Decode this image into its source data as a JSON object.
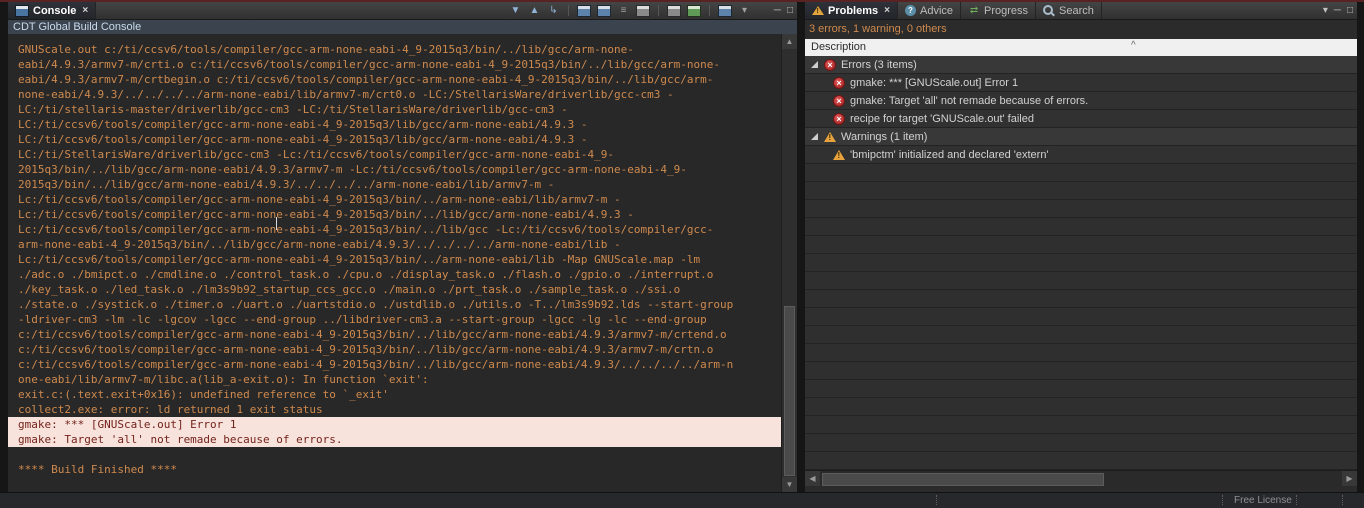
{
  "glyphs": {
    "close": "×"
  },
  "colors": {
    "accent_maroon": "#5a2323",
    "console_text": "#cf8a4e",
    "error_line_bg": "#f7e2dc",
    "error_line_text": "#74231b",
    "error_icon": "#b32424",
    "warning_icon": "#e8a33d"
  },
  "console_view": {
    "tab_label": "Console",
    "subtitle": "CDT Global Build Console",
    "toolbar": [
      {
        "name": "next-error-icon",
        "glyph": "▼",
        "cls": "blue"
      },
      {
        "name": "previous-error-icon",
        "glyph": "▲",
        "cls": "blue"
      },
      {
        "name": "show-error-in-editor-icon",
        "glyph": "↳",
        "cls": "blue"
      },
      {
        "sep": true
      },
      {
        "name": "copy-build-log-icon",
        "win": ""
      },
      {
        "name": "open-build-console-icon",
        "win": ""
      },
      {
        "name": "word-wrap-icon",
        "glyph": "≡",
        "cls": "gray"
      },
      {
        "name": "clear-console-icon",
        "win": "gray"
      },
      {
        "sep": true
      },
      {
        "name": "scroll-lock-icon",
        "win": "gray"
      },
      {
        "name": "pin-console-icon",
        "win": "green"
      },
      {
        "sep": true
      },
      {
        "name": "display-selected-console-icon",
        "win": ""
      },
      {
        "name": "open-console-dropdown-icon",
        "glyph": "▾",
        "cls": "gray"
      }
    ],
    "window_icons": [
      {
        "name": "minimize-icon",
        "glyph": "─"
      },
      {
        "name": "maximize-icon",
        "glyph": "□"
      }
    ],
    "lines": [
      {
        "text": "GNUScale.out c:/ti/ccsv6/tools/compiler/gcc-arm-none-eabi-4_9-2015q3/bin/../lib/gcc/arm-none-"
      },
      {
        "text": "eabi/4.9.3/armv7-m/crti.o c:/ti/ccsv6/tools/compiler/gcc-arm-none-eabi-4_9-2015q3/bin/../lib/gcc/arm-none-"
      },
      {
        "text": "eabi/4.9.3/armv7-m/crtbegin.o c:/ti/ccsv6/tools/compiler/gcc-arm-none-eabi-4_9-2015q3/bin/../lib/gcc/arm-"
      },
      {
        "text": "none-eabi/4.9.3/../../../../arm-none-eabi/lib/armv7-m/crt0.o -LC:/StellarisWare/driverlib/gcc-cm3 -"
      },
      {
        "text": "LC:/ti/stellaris-master/driverlib/gcc-cm3 -LC:/ti/StellarisWare/driverlib/gcc-cm3 -"
      },
      {
        "text": "LC:/ti/ccsv6/tools/compiler/gcc-arm-none-eabi-4_9-2015q3/lib/gcc/arm-none-eabi/4.9.3 -"
      },
      {
        "text": "LC:/ti/ccsv6/tools/compiler/gcc-arm-none-eabi-4_9-2015q3/lib/gcc/arm-none-eabi/4.9.3 -"
      },
      {
        "text": "LC:/ti/StellarisWare/driverlib/gcc-cm3 -Lc:/ti/ccsv6/tools/compiler/gcc-arm-none-eabi-4_9-"
      },
      {
        "text": "2015q3/bin/../lib/gcc/arm-none-eabi/4.9.3/armv7-m -Lc:/ti/ccsv6/tools/compiler/gcc-arm-none-eabi-4_9-"
      },
      {
        "text": "2015q3/bin/../lib/gcc/arm-none-eabi/4.9.3/../../../../arm-none-eabi/lib/armv7-m -"
      },
      {
        "text": "Lc:/ti/ccsv6/tools/compiler/gcc-arm-none-eabi-4_9-2015q3/bin/../arm-none-eabi/lib/armv7-m -"
      },
      {
        "text": "Lc:/ti/ccsv6/tools/compiler/gcc-arm-none-eabi-4_9-2015q3/bin/../lib/gcc/arm-none-eabi/4.9.3 -"
      },
      {
        "text": "Lc:/ti/ccsv6/tools/compiler/gcc-arm-none-eabi-4_9-2015q3/bin/../lib/gcc -Lc:/ti/ccsv6/tools/compiler/gcc-"
      },
      {
        "text": "arm-none-eabi-4_9-2015q3/bin/../lib/gcc/arm-none-eabi/4.9.3/../../../../arm-none-eabi/lib -"
      },
      {
        "text": "Lc:/ti/ccsv6/tools/compiler/gcc-arm-none-eabi-4_9-2015q3/bin/../arm-none-eabi/lib -Map GNUScale.map -lm"
      },
      {
        "text": "./adc.o ./bmipct.o ./cmdline.o ./control_task.o ./cpu.o ./display_task.o ./flash.o ./gpio.o ./interrupt.o"
      },
      {
        "text": "./key_task.o ./led_task.o ./lm3s9b92_startup_ccs_gcc.o ./main.o ./prt_task.o ./sample_task.o ./ssi.o"
      },
      {
        "text": "./state.o ./systick.o ./timer.o ./uart.o ./uartstdio.o ./ustdlib.o ./utils.o -T../lm3s9b92.lds --start-group"
      },
      {
        "text": "-ldriver-cm3 -lm -lc -lgcov -lgcc --end-group ../libdriver-cm3.a --start-group -lgcc -lg -lc --end-group"
      },
      {
        "text": "c:/ti/ccsv6/tools/compiler/gcc-arm-none-eabi-4_9-2015q3/bin/../lib/gcc/arm-none-eabi/4.9.3/armv7-m/crtend.o"
      },
      {
        "text": "c:/ti/ccsv6/tools/compiler/gcc-arm-none-eabi-4_9-2015q3/bin/../lib/gcc/arm-none-eabi/4.9.3/armv7-m/crtn.o"
      },
      {
        "text": "c:/ti/ccsv6/tools/compiler/gcc-arm-none-eabi-4_9-2015q3/bin/../lib/gcc/arm-none-eabi/4.9.3/../../../../arm-n"
      },
      {
        "text": "one-eabi/lib/armv7-m/libc.a(lib_a-exit.o): In function `exit':"
      },
      {
        "text": "exit.c:(.text.exit+0x16): undefined reference to `_exit'"
      },
      {
        "text": "collect2.exe: error: ld returned 1 exit status"
      },
      {
        "text": "gmake: *** [GNUScale.out] Error 1",
        "style": "error"
      },
      {
        "text": "gmake: Target 'all' not remade because of errors.",
        "style": "error"
      },
      {
        "text": ""
      },
      {
        "text": "**** Build Finished ****"
      }
    ]
  },
  "problems_view": {
    "tabs": [
      {
        "label": "Problems",
        "active": true,
        "closable": true,
        "icon": "problems-icon"
      },
      {
        "label": "Advice",
        "icon": "advice-icon"
      },
      {
        "label": "Progress",
        "icon": "progress-icon"
      },
      {
        "label": "Search",
        "icon": "search-icon"
      }
    ],
    "window_icons": [
      {
        "name": "view-menu-icon",
        "glyph": "▾"
      },
      {
        "name": "minimize-icon",
        "glyph": "─"
      },
      {
        "name": "maximize-icon",
        "glyph": "□"
      }
    ],
    "summary": "3 errors, 1 warning, 0 others",
    "column_header": "Description",
    "rows": [
      {
        "kind": "group",
        "severity": "error",
        "label": "Errors (3 items)"
      },
      {
        "kind": "item",
        "severity": "error",
        "label": "gmake: *** [GNUScale.out] Error 1"
      },
      {
        "kind": "item",
        "severity": "error",
        "label": "gmake: Target 'all' not remade because of errors."
      },
      {
        "kind": "item",
        "severity": "error",
        "label": "recipe for target 'GNUScale.out' failed"
      },
      {
        "kind": "group",
        "severity": "warning",
        "label": "Warnings (1 item)"
      },
      {
        "kind": "item",
        "severity": "warning",
        "label": "'bmipctm' initialized and declared 'extern'"
      }
    ],
    "empty_row_count": 17
  },
  "status_bar": {
    "license_label": "Free License"
  }
}
